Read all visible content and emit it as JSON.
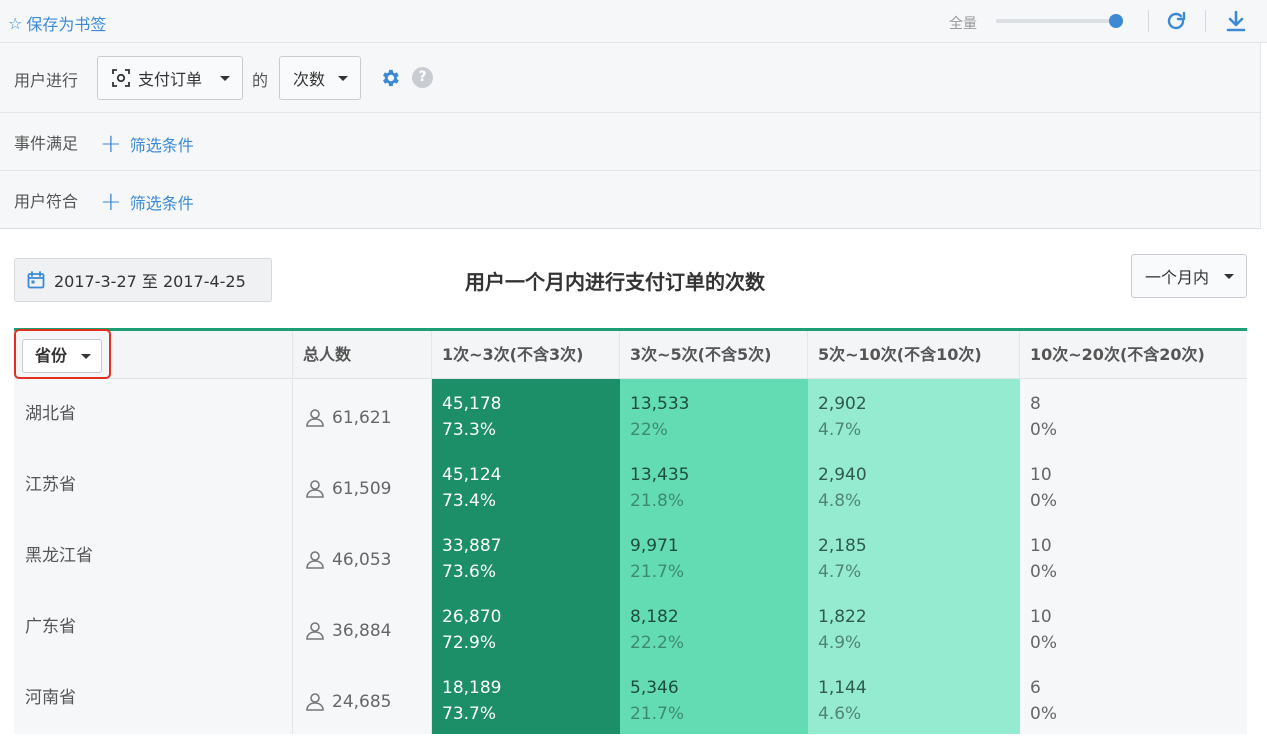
{
  "toolbar": {
    "bookmark_label": "保存为书签",
    "full_label": "全量",
    "slider_value": 1.0
  },
  "query": {
    "user_do_label": "用户进行",
    "event_value": "支付订单",
    "de_label": "的",
    "metric_value": "次数",
    "event_filter_label": "事件满足",
    "user_filter_label": "用户符合",
    "add_filter_label": "筛选条件"
  },
  "report": {
    "date_range": "2017-3-27 至 2017-4-25",
    "title": "用户一个月内进行支付订单的次数",
    "period_value": "一个月内"
  },
  "table": {
    "dimension_select": "省份",
    "headers": [
      "总人数",
      "1次~3次(不含3次)",
      "3次~5次(不含5次)",
      "5次~10次(不含10次)",
      "10次~20次(不含20次)"
    ],
    "rows": [
      {
        "province": "湖北省",
        "total": "61,621",
        "b1": "45,178",
        "p1": "73.3%",
        "b2": "13,533",
        "p2": "22%",
        "b3": "2,902",
        "p3": "4.7%",
        "b4": "8",
        "p4": "0%"
      },
      {
        "province": "江苏省",
        "total": "61,509",
        "b1": "45,124",
        "p1": "73.4%",
        "b2": "13,435",
        "p2": "21.8%",
        "b3": "2,940",
        "p3": "4.8%",
        "b4": "10",
        "p4": "0%"
      },
      {
        "province": "黑龙江省",
        "total": "46,053",
        "b1": "33,887",
        "p1": "73.6%",
        "b2": "9,971",
        "p2": "21.7%",
        "b3": "2,185",
        "p3": "4.7%",
        "b4": "10",
        "p4": "0%"
      },
      {
        "province": "广东省",
        "total": "36,884",
        "b1": "26,870",
        "p1": "72.9%",
        "b2": "8,182",
        "p2": "22.2%",
        "b3": "1,822",
        "p3": "4.9%",
        "b4": "10",
        "p4": "0%"
      },
      {
        "province": "河南省",
        "total": "24,685",
        "b1": "18,189",
        "p1": "73.7%",
        "b2": "5,346",
        "p2": "21.7%",
        "b3": "1,144",
        "p3": "4.6%",
        "b4": "6",
        "p4": "0%"
      }
    ]
  },
  "colors": {
    "accent": "#3c8ad6",
    "bucket1": "#1d8f68",
    "bucket2": "#63dcb3",
    "bucket3": "#95ebd0",
    "highlight": "#e0311e"
  }
}
